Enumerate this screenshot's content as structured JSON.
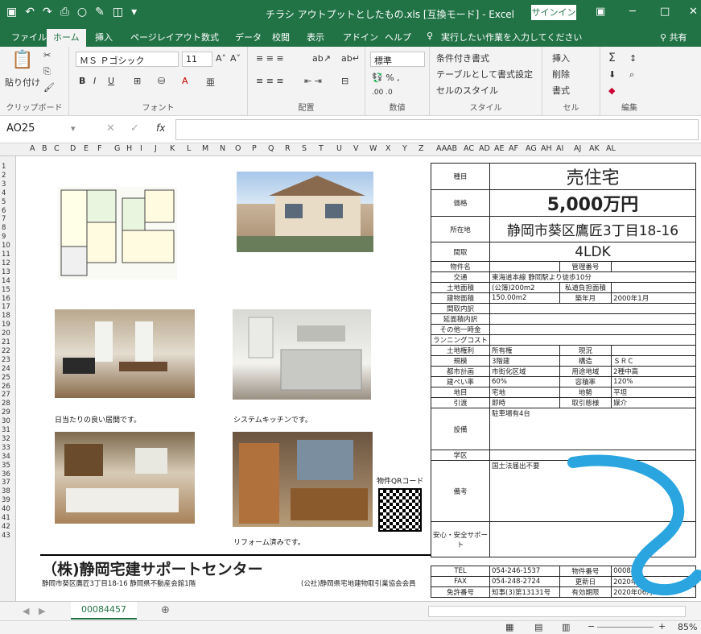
{
  "titlebar": {
    "title": "チラシ アウトプットとしたもの.xls [互換モード] - Excel",
    "signin": "サインイン"
  },
  "tabs": [
    "ファイル",
    "ホーム",
    "挿入",
    "ページレイアウト",
    "数式",
    "データ",
    "校閲",
    "表示",
    "アドイン",
    "ヘルプ"
  ],
  "tellme": "実行したい作業を入力してください",
  "share": "共有",
  "ribbon": {
    "clipboard": {
      "paste": "貼り付け",
      "label": "クリップボード"
    },
    "font": {
      "name": "ＭＳ Ｐゴシック",
      "size": "11",
      "label": "フォント"
    },
    "alignment": {
      "label": "配置"
    },
    "number": {
      "format": "標準",
      "label": "数値"
    },
    "styles": {
      "cond": "条件付き書式",
      "table": "テーブルとして書式設定",
      "cell": "セルのスタイル",
      "label": "スタイル"
    },
    "cells": {
      "insert": "挿入",
      "delete": "削除",
      "format": "書式",
      "label": "セル"
    },
    "editing": {
      "label": "編集"
    }
  },
  "formula": {
    "namebox": "AO25",
    "fx": "fx"
  },
  "columns": [
    "A",
    "B",
    "C",
    "D",
    "E",
    "F",
    "G",
    "H",
    "I",
    "J",
    "K",
    "L",
    "M",
    "N",
    "O",
    "P",
    "Q",
    "R",
    "S",
    "T",
    "U",
    "V",
    "W",
    "X",
    "Y",
    "Z",
    "AA",
    "AB",
    "AC",
    "AD",
    "AE",
    "AF",
    "AG",
    "AH",
    "AI",
    "AJ",
    "AK",
    "AL"
  ],
  "captions": {
    "living": "日当たりの良い居間です。",
    "kitchen": "システムキッチンです。",
    "reform": "リフォーム済みです。",
    "qr": "物件QRコード"
  },
  "info": {
    "type_label": "種目",
    "type": "売住宅",
    "price_label": "価格",
    "price": "5,000万円",
    "loc_label": "所在地",
    "loc": "静岡市葵区鷹匠3丁目18-16",
    "madori_label": "間取",
    "madori": "4LDK",
    "name_label": "物件名",
    "mgmt_label": "管理番号",
    "access_label": "交通",
    "access": "東海道本線 静岡駅より徒歩10分",
    "land_label": "土地面積",
    "land": "(公簿)200m2",
    "road_label": "私道負担面積",
    "bldg_label": "建物面積",
    "bldg": "150.00m2",
    "built_label": "築年月",
    "built": "2000年1月",
    "room_detail": "間取内訳",
    "floor_detail": "延面積内訳",
    "other": "その他一時金",
    "running": "ランニングコスト",
    "right_label": "土地権利",
    "right": "所有権",
    "status_label": "現況",
    "scale_label": "規模",
    "scale": "3階建",
    "structure_label": "構造",
    "structure": "ＳＲＣ",
    "city_label": "都市計画",
    "city": "市街化区域",
    "zone_label": "用途地域",
    "zone": "2種中高",
    "bcr_label": "建ぺい率",
    "bcr": "60%",
    "far_label": "容積率",
    "far": "120%",
    "chimoku_label": "地目",
    "chimoku": "宅地",
    "terrain_label": "地勢",
    "terrain": "平坦",
    "handover_label": "引渡",
    "handover": "即時",
    "deal_label": "取引態様",
    "deal": "媒介",
    "facility_label": "設備",
    "facility": "駐車場有4台",
    "school_label": "学区",
    "remarks_label": "備考",
    "remarks": "国土法届出不要",
    "safety_label": "安心・安全サポート",
    "tel_label": "TEL",
    "tel": "054-246-1537",
    "propno_label": "物件番号",
    "propno": "000844",
    "fax_label": "FAX",
    "fax": "054-248-2724",
    "update_label": "更新日",
    "update": "2020年0",
    "license_label": "免許番号",
    "license": "知事(3)第13131号",
    "valid_label": "有効期限",
    "valid": "2020年06月20日"
  },
  "company": {
    "name": "（株)静岡宅建サポートセンター",
    "address": "静岡市葵区鷹匠3丁目18-16 静岡県不動産会館1階",
    "assoc": "(公社)静岡県宅地建物取引業協会会員"
  },
  "sheet": {
    "tab": "00084457",
    "zoom": "85%"
  }
}
